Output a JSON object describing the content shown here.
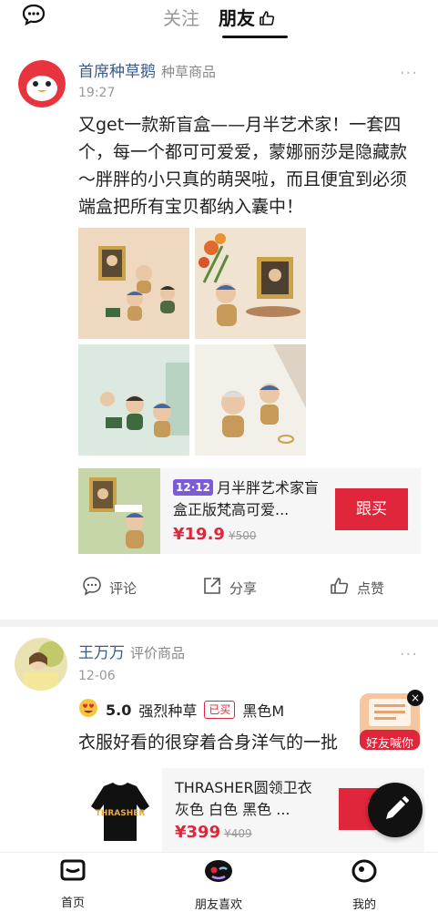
{
  "header": {
    "tabs": [
      {
        "label": "关注",
        "active": false
      },
      {
        "label": "朋友",
        "active": true
      }
    ],
    "chat_icon": "message-bubble-icon",
    "thumb_icon": "thumbs-up-icon"
  },
  "posts": [
    {
      "author": "首席种草鹅",
      "tag": "种草商品",
      "time": "19:27",
      "more": "···",
      "text": "又get一款新盲盒——月半艺术家！一套四个，每一个都可可爱爱，蒙娜丽莎是隐藏款～胖胖的小只真的萌哭啦，而且便宜到必须端盒把所有宝贝都纳入囊中！",
      "images_count": 4,
      "product": {
        "badge": "12·12",
        "title": "月半胖艺术家盲盒正版梵高可爱...",
        "price": "¥19.9",
        "old_price": "¥500",
        "buy_label": "跟买"
      },
      "actions": [
        {
          "label": "评论",
          "icon": "comment-icon"
        },
        {
          "label": "分享",
          "icon": "share-icon"
        },
        {
          "label": "点赞",
          "icon": "like-icon"
        }
      ]
    },
    {
      "author": "王万万",
      "tag": "评价商品",
      "time": "12-06",
      "more": "···",
      "rating": "5.0",
      "rating_label": "强烈种草",
      "bought_tag": "已买",
      "variant": "黑色M",
      "text": "衣服好看的很穿着合身洋气的一批",
      "product": {
        "title": "THRASHER圆领卫衣 灰色 白色 黑色 ...",
        "price": "¥399",
        "old_price": "¥409",
        "buy_label": "跟"
      }
    }
  ],
  "floating": {
    "share_label": "好友喊你",
    "close_label": "×"
  },
  "bottom_nav": [
    {
      "label": "首页",
      "icon": "home-icon"
    },
    {
      "label": "朋友喜欢",
      "icon": "friends-like-icon"
    },
    {
      "label": "我的",
      "icon": "profile-icon"
    }
  ],
  "colors": {
    "accent_red": "#e0263b",
    "name_blue": "#3a5a8c",
    "badge_purple": "#7b5cd6"
  }
}
